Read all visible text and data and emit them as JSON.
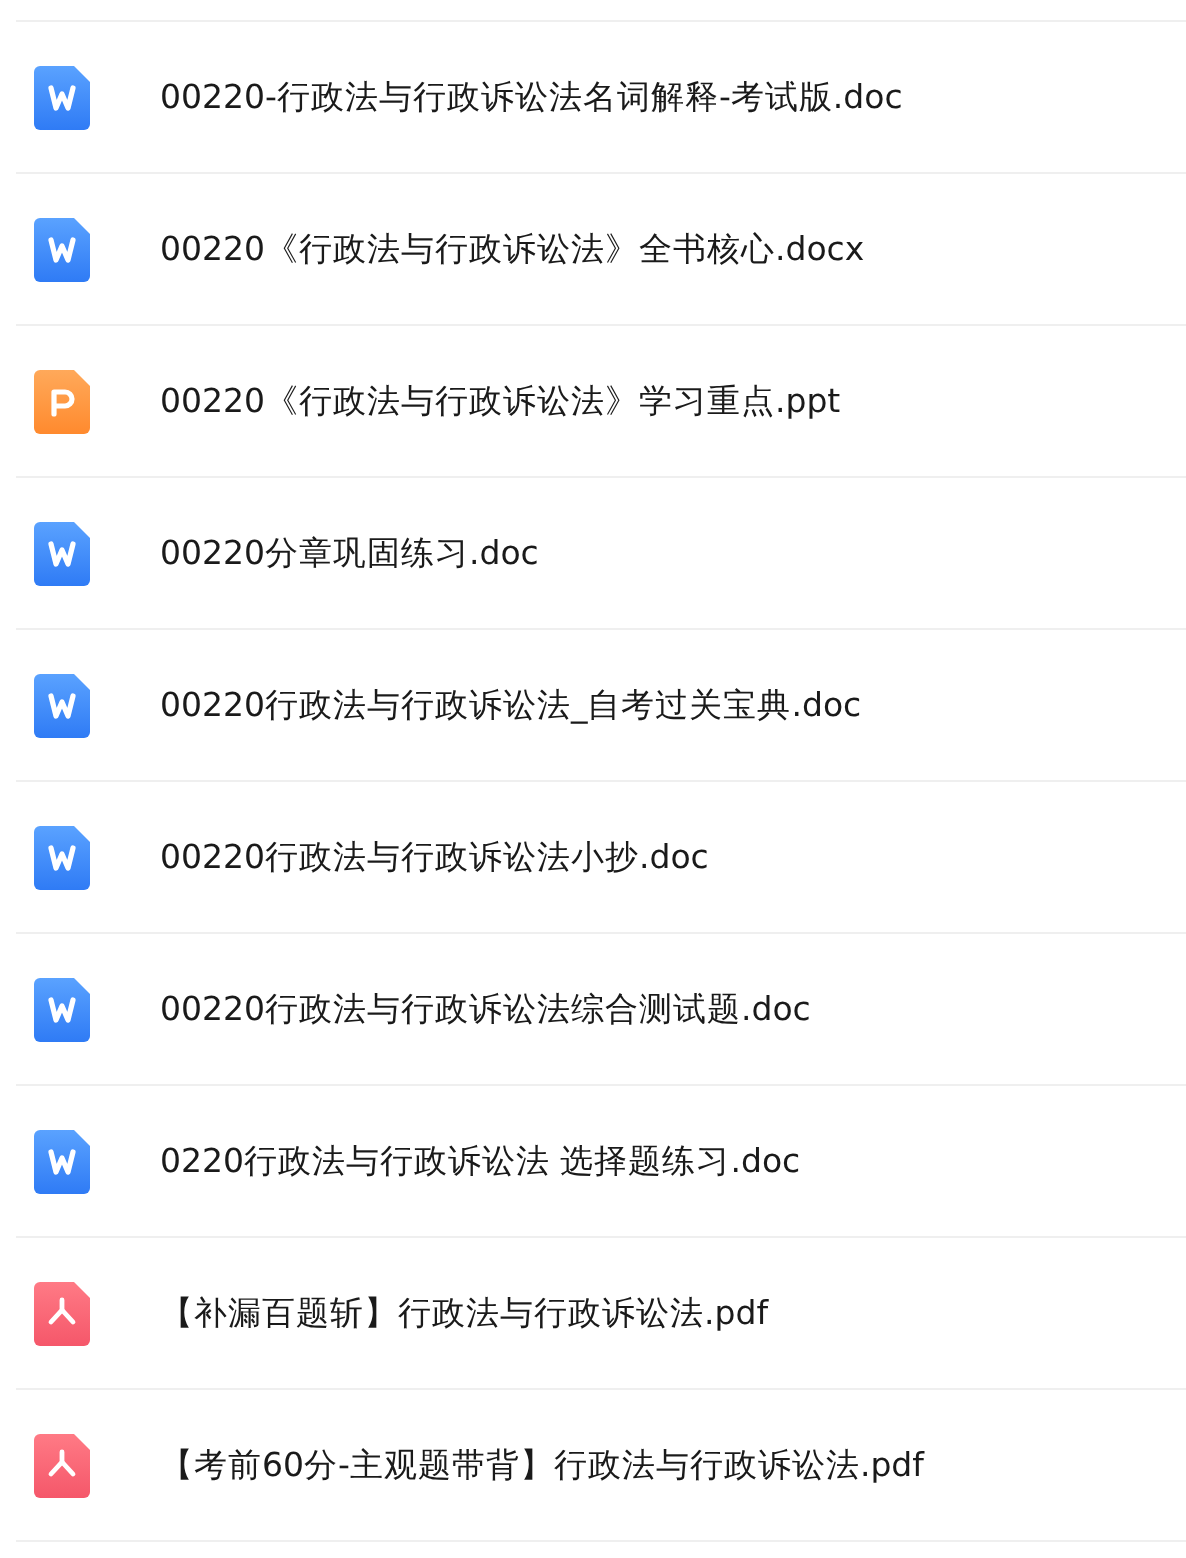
{
  "files": [
    {
      "kind": "word",
      "name": "00220-行政法与行政诉讼法名词解释-考试版.doc"
    },
    {
      "kind": "word",
      "name": "00220《行政法与行政诉讼法》全书核心.docx"
    },
    {
      "kind": "ppt",
      "name": "00220《行政法与行政诉讼法》学习重点.ppt"
    },
    {
      "kind": "word",
      "name": "00220分章巩固练习.doc"
    },
    {
      "kind": "word",
      "name": "00220行政法与行政诉讼法_自考过关宝典.doc"
    },
    {
      "kind": "word",
      "name": "00220行政法与行政诉讼法小抄.doc"
    },
    {
      "kind": "word",
      "name": "00220行政法与行政诉讼法综合测试题.doc"
    },
    {
      "kind": "word",
      "name": "0220行政法与行政诉讼法 选择题练习.doc"
    },
    {
      "kind": "pdf",
      "name": "【补漏百题斩】行政法与行政诉讼法.pdf"
    },
    {
      "kind": "pdf",
      "name": "【考前60分-主观题带背】行政法与行政诉讼法.pdf"
    }
  ]
}
